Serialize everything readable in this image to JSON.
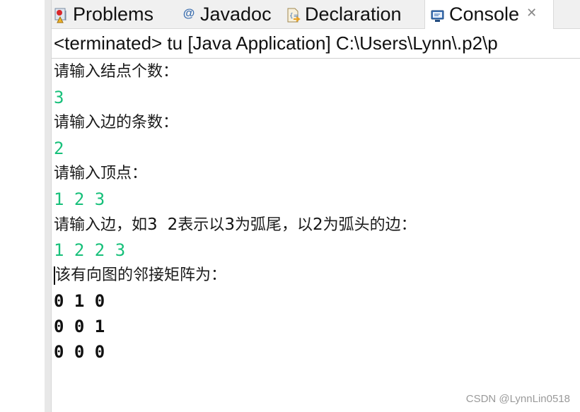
{
  "tabs": [
    {
      "label": "Problems",
      "icon": "problems-icon"
    },
    {
      "label": "Javadoc",
      "icon": "javadoc-at-icon"
    },
    {
      "label": "Declaration",
      "icon": "declaration-icon"
    },
    {
      "label": "Console",
      "icon": "console-monitor-icon",
      "active": true,
      "close_icon": "close-icon"
    }
  ],
  "console": {
    "header": "<terminated> tu [Java Application] C:\\Users\\Lynn\\.p2\\p",
    "lines": {
      "prompt_nodes": "请输入结点个数：",
      "input_nodes": "3",
      "prompt_edges": "请输入边的条数：",
      "input_edges": "2",
      "prompt_vertices": "请输入顶点：",
      "input_vertices": "1 2 3",
      "prompt_edge_a": "请输入边，如",
      "prompt_edge_n1": "3",
      "prompt_edge_sp": "  ",
      "prompt_edge_n2": "2",
      "prompt_edge_b": "表示以",
      "prompt_edge_n3": "3",
      "prompt_edge_c": "为弧尾，以",
      "prompt_edge_n4": "2",
      "prompt_edge_d": "为弧头的边：",
      "input_edges_list": "1 2 2 3",
      "result_label": "该有向图的邻接矩阵为：",
      "matrix": [
        "0 1 0",
        "0 0 1",
        "0 0 0"
      ]
    }
  },
  "colors": {
    "user_input": "#17c07a",
    "active_tab_bg": "#ffffff",
    "tabbar_bg": "#f0f0f0"
  },
  "watermark": "CSDN @LynnLin0518"
}
